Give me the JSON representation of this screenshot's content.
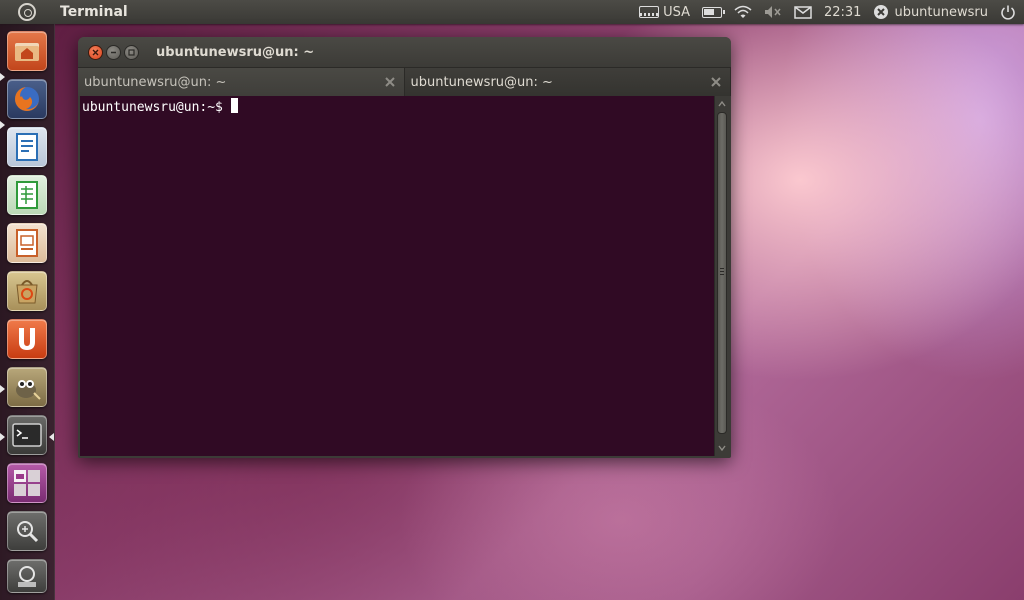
{
  "panel": {
    "app_title": "Terminal",
    "keyboard_layout": "USA",
    "time": "22:31",
    "user": "ubuntunewsru",
    "icons": [
      "ubuntu-logo-icon",
      "keyboard-icon",
      "battery-icon",
      "wifi-icon",
      "volume-muted-icon",
      "mail-icon",
      "user-status-icon",
      "power-icon"
    ]
  },
  "launcher": {
    "items": [
      {
        "name": "home-folder",
        "icon": "home-folder-icon",
        "color": "#d25c2c"
      },
      {
        "name": "firefox",
        "icon": "firefox-icon",
        "color": "#e0762a"
      },
      {
        "name": "libreoffice-writer",
        "icon": "writer-icon",
        "color": "#2b6fb5"
      },
      {
        "name": "libreoffice-calc",
        "icon": "calc-icon",
        "color": "#2f9a3a"
      },
      {
        "name": "libreoffice-impress",
        "icon": "impress-icon",
        "color": "#c8602a"
      },
      {
        "name": "software-center",
        "icon": "software-center-icon",
        "color": "#b89a4a"
      },
      {
        "name": "ubuntu-one",
        "icon": "ubuntu-one-icon",
        "color": "#dd4814"
      },
      {
        "name": "gimp",
        "icon": "gimp-icon",
        "color": "#8a7a52"
      },
      {
        "name": "terminal",
        "icon": "terminal-icon",
        "color": "#4a4a4a"
      },
      {
        "name": "workspaces",
        "icon": "workspaces-icon",
        "color": "#9a3a8a"
      },
      {
        "name": "dash-apps",
        "icon": "dash-icon",
        "color": "#5a5a5a"
      },
      {
        "name": "dash-files",
        "icon": "files-lens-icon",
        "color": "#5a5a5a"
      }
    ]
  },
  "window": {
    "title": "ubuntunewsru@un: ~",
    "tabs": [
      {
        "label": "ubuntunewsru@un: ~",
        "active": false
      },
      {
        "label": "ubuntunewsru@un: ~",
        "active": true
      }
    ],
    "prompt": "ubuntunewsru@un:~$",
    "colors": {
      "terminal_bg": "#300a24",
      "close_button": "#e95420"
    }
  }
}
